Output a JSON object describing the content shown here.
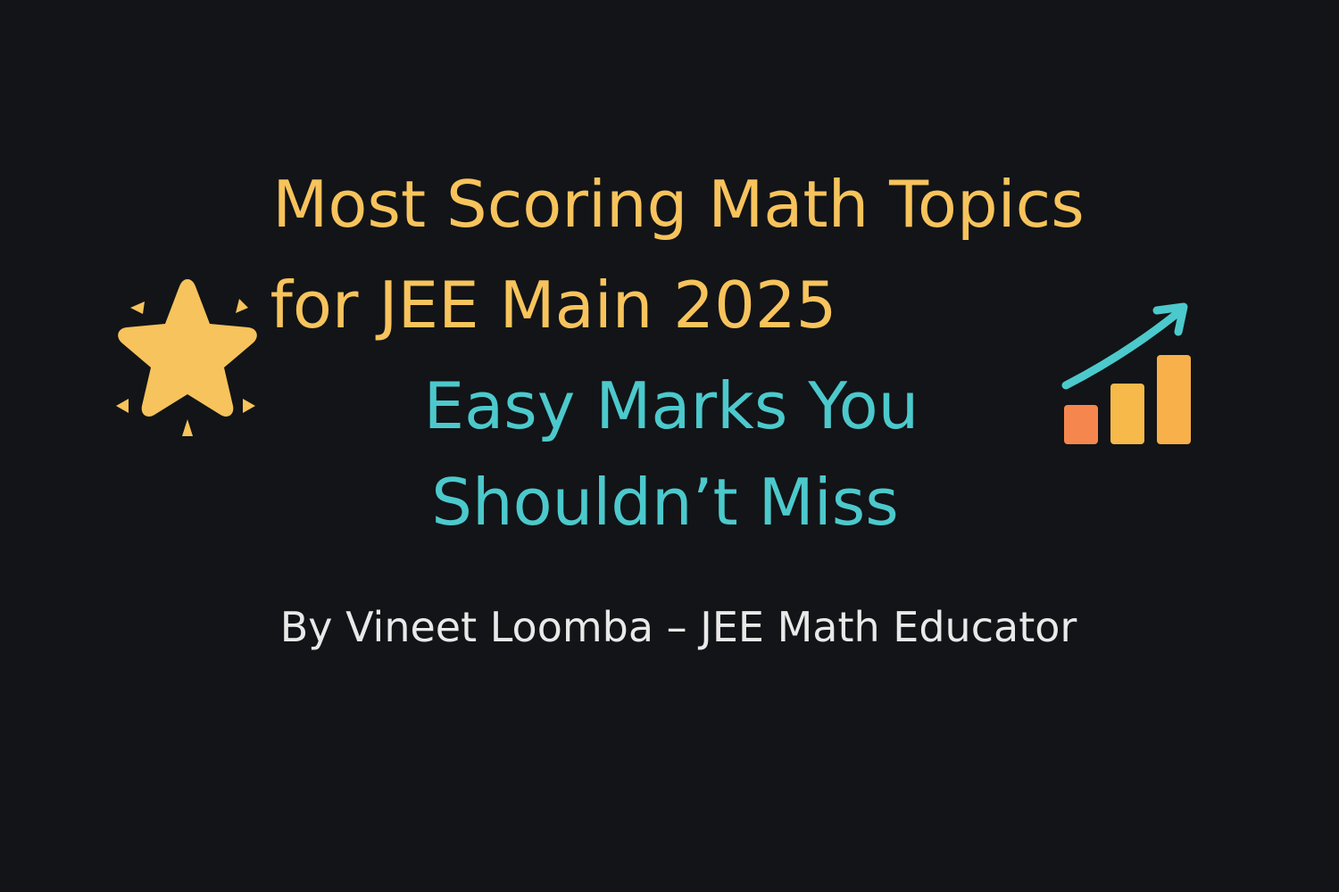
{
  "title": {
    "line1": "Most Scoring Math Topics",
    "line2": "for JEE Main 2025"
  },
  "subtitle": {
    "line1": "Easy Marks You",
    "line2": "Shouldn’t Miss"
  },
  "byline": "By Vineet Loomba – JEE Math Educator",
  "icons": {
    "left": "sparkling-star-icon",
    "right": "growth-bar-chart-icon"
  },
  "colors": {
    "background": "#121417",
    "title": "#f7c35c",
    "subtitle": "#4cc9cc",
    "byline": "#e9e9e9",
    "bar_small": "#f5874e",
    "bar_medium": "#f7b94a",
    "bar_large": "#f7b04a",
    "arrow": "#4cc9cc"
  }
}
